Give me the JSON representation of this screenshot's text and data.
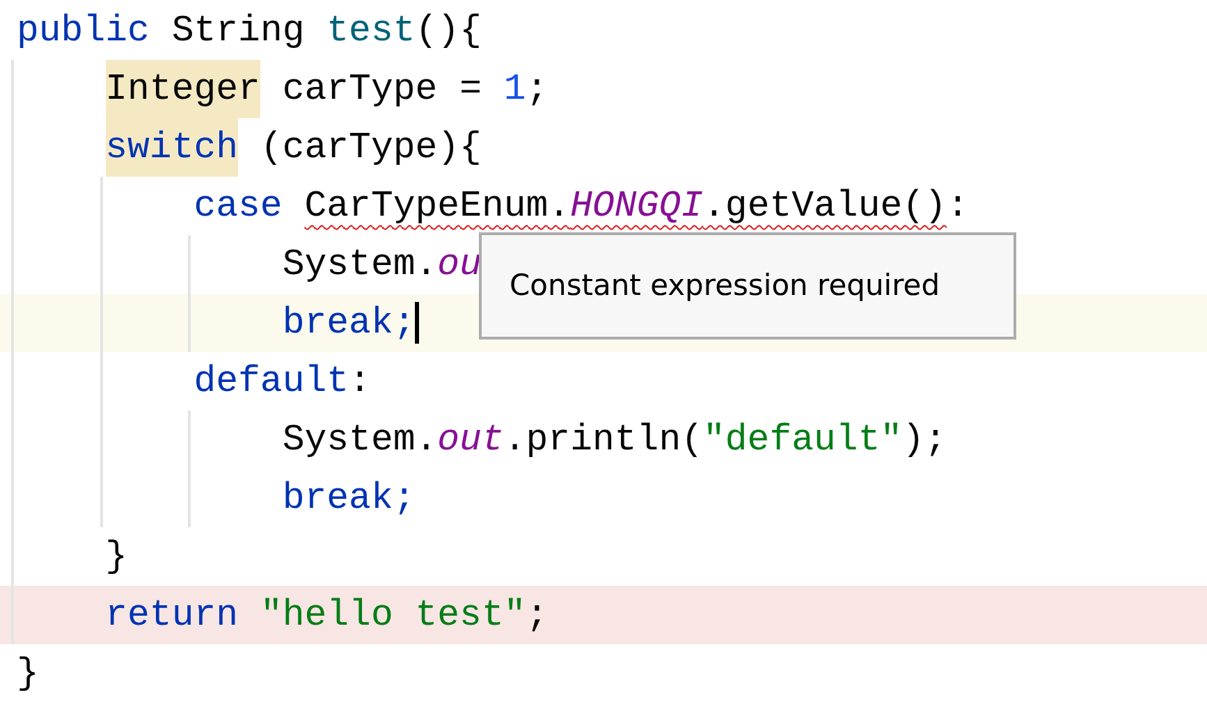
{
  "editor": {
    "lines": [
      {
        "tokens": [
          {
            "text": "public",
            "kind": "keyword",
            "space": true
          },
          {
            "text": "String",
            "kind": "plain",
            "space": true
          },
          {
            "text": "test",
            "kind": "method"
          },
          {
            "text": "(){",
            "kind": "plain"
          }
        ],
        "children": [
          {
            "tokens": [
              {
                "text": "Integer",
                "kind": "plain",
                "match_highlight": true,
                "space": true
              },
              {
                "text": "carType = ",
                "kind": "plain"
              },
              {
                "text": "1",
                "kind": "number"
              },
              {
                "text": ";",
                "kind": "plain"
              }
            ]
          },
          {
            "tokens": [
              {
                "text": "switch",
                "kind": "keyword",
                "match_highlight": true,
                "space": true
              },
              {
                "text": "(carType){",
                "kind": "plain"
              }
            ],
            "children": [
              {
                "tokens": [
                  {
                    "text": "case",
                    "kind": "keyword",
                    "space": true
                  },
                  {
                    "text": "CarTypeEnum.",
                    "kind": "plain",
                    "error": true
                  },
                  {
                    "text": "HONGQI",
                    "kind": "static",
                    "error": true
                  },
                  {
                    "text": ".getValue()",
                    "kind": "plain",
                    "error": true
                  },
                  {
                    "text": ":",
                    "kind": "plain"
                  }
                ],
                "children": [
                  {
                    "tokens": [
                      {
                        "text": "System.",
                        "kind": "plain"
                      },
                      {
                        "text": "ou",
                        "kind": "static"
                      }
                    ]
                  },
                  {
                    "tokens": [
                      {
                        "text": "break;",
                        "kind": "keyword"
                      }
                    ],
                    "current": true,
                    "caret": true
                  }
                ]
              },
              {
                "tokens": [
                  {
                    "text": "default",
                    "kind": "keyword"
                  },
                  {
                    "text": ":",
                    "kind": "plain"
                  }
                ],
                "children": [
                  {
                    "tokens": [
                      {
                        "text": "System.",
                        "kind": "plain"
                      },
                      {
                        "text": "out",
                        "kind": "static"
                      },
                      {
                        "text": ".println(",
                        "kind": "plain"
                      },
                      {
                        "text": "\"default\"",
                        "kind": "string"
                      },
                      {
                        "text": ");",
                        "kind": "plain"
                      }
                    ]
                  },
                  {
                    "tokens": [
                      {
                        "text": "break;",
                        "kind": "keyword"
                      }
                    ]
                  }
                ]
              }
            ]
          },
          {
            "tokens": [
              {
                "text": "}",
                "kind": "plain"
              }
            ]
          },
          {
            "tokens": [
              {
                "text": "return",
                "kind": "keyword",
                "space": true
              },
              {
                "text": "\"hello test\"",
                "kind": "string"
              },
              {
                "text": ";",
                "kind": "plain"
              }
            ],
            "error_line": true
          }
        ]
      },
      {
        "tokens": [
          {
            "text": "}",
            "kind": "plain"
          }
        ]
      }
    ]
  },
  "tooltip": {
    "text": "Constant expression required"
  }
}
